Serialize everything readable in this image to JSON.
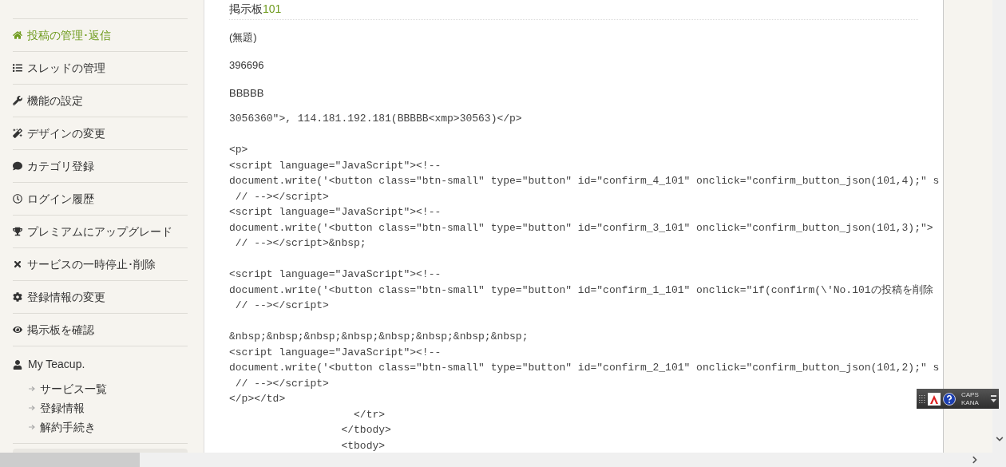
{
  "sidebar": {
    "items": [
      {
        "label": "投稿の管理･返信",
        "selected": true
      },
      {
        "label": "スレッドの管理",
        "selected": false
      },
      {
        "label": "機能の設定",
        "selected": false
      },
      {
        "label": "デザインの変更",
        "selected": false
      },
      {
        "label": "カテゴリ登録",
        "selected": false
      },
      {
        "label": "ログイン履歴",
        "selected": false
      },
      {
        "label": "プレミアムにアップグレード",
        "selected": false
      },
      {
        "label": "サービスの一時停止･削除",
        "selected": false
      },
      {
        "label": "登録情報の変更",
        "selected": false
      },
      {
        "label": "掲示板を確認",
        "selected": false
      }
    ],
    "account": {
      "title": "My Teacup.",
      "links": [
        "サービス一覧",
        "登録情報",
        "解約手続き"
      ]
    }
  },
  "content": {
    "heading": {
      "text": "掲示板",
      "number": "101"
    },
    "fields": [
      "(無題)",
      "396696",
      "BBBBB"
    ],
    "code_blocks": [
      [
        "3056360\">, 114.181.192.181(BBBBB<xmp>30563)</p>"
      ],
      [
        "<p>",
        "<script language=\"JavaScript\"><!--",
        "document.write('<button class=\"btn-small\" type=\"button\" id=\"confirm_4_101\" onclick=\"confirm_button_json(101,4);\" s",
        " // --></script>",
        "<script language=\"JavaScript\"><!--",
        "document.write('<button class=\"btn-small\" type=\"button\" id=\"confirm_3_101\" onclick=\"confirm_button_json(101,3);\">",
        " // --></script>&nbsp;"
      ],
      [
        "<script language=\"JavaScript\"><!--",
        "document.write('<button class=\"btn-small\" type=\"button\" id=\"confirm_1_101\" onclick=\"if(confirm(\\'No.101の投稿を削除",
        " // --></script>"
      ],
      [
        "&nbsp;&nbsp;&nbsp;&nbsp;&nbsp;&nbsp;&nbsp;&nbsp;",
        "<script language=\"JavaScript\"><!--",
        "document.write('<button class=\"btn-small\" type=\"button\" id=\"confirm_2_101\" onclick=\"confirm_button_json(101,2);\" s",
        " // --></script>",
        "</p></td>",
        "                    </tr>",
        "                  </tbody>",
        "                  <tbody>"
      ]
    ]
  },
  "ime_bar": {
    "labels": [
      "CAPS",
      "KANA"
    ]
  }
}
